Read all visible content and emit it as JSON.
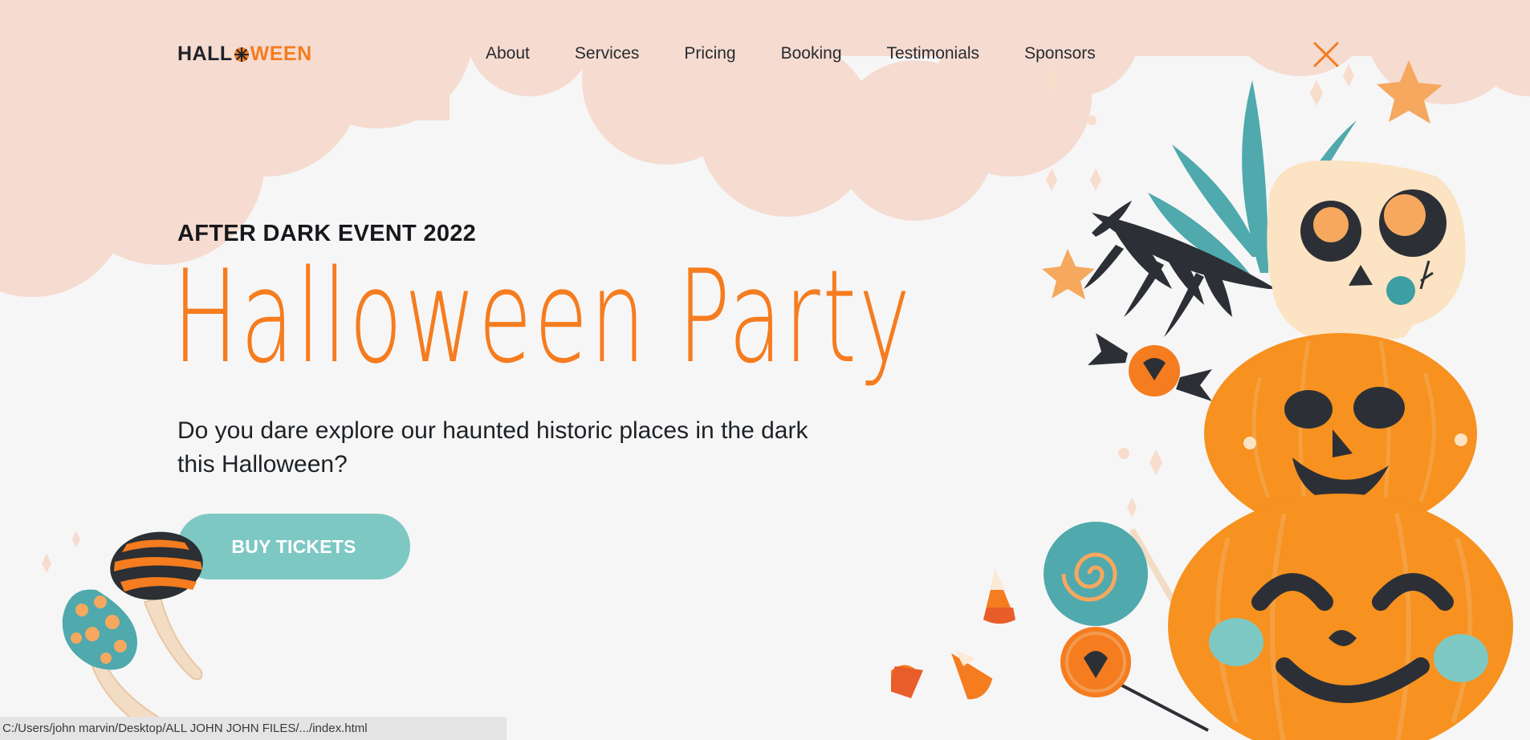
{
  "header": {
    "logo": {
      "prefix": "HALL",
      "suffix": "WEEN"
    },
    "nav": [
      {
        "label": "About"
      },
      {
        "label": "Services"
      },
      {
        "label": "Pricing"
      },
      {
        "label": "Booking"
      },
      {
        "label": "Testimonials"
      },
      {
        "label": "Sponsors"
      }
    ],
    "close_icon": "close-x-icon"
  },
  "hero": {
    "eyebrow": "AFTER DARK EVENT 2022",
    "title": "Halloween Party",
    "description": "Do you dare explore our haunted historic places in the dark this Halloween?",
    "cta_label": "BUY TICKETS"
  },
  "status_bar": {
    "url": "C:/Users/john marvin/Desktop/ALL JOHN JOHN FILES/.../index.html"
  },
  "colors": {
    "accent": "#f57c1f",
    "cloud": "#f6dbd0",
    "button": "#7ec8c4",
    "background": "#f6f6f6",
    "text": "#1e2226"
  },
  "icons": [
    "pumpkin-logo-icon",
    "close-x-icon",
    "skull-icon",
    "jack-o-lantern-icon",
    "candy-icon",
    "lollipop-icon",
    "candy-corn-icon",
    "mushroom-icon",
    "star-icon",
    "leaf-icon"
  ]
}
